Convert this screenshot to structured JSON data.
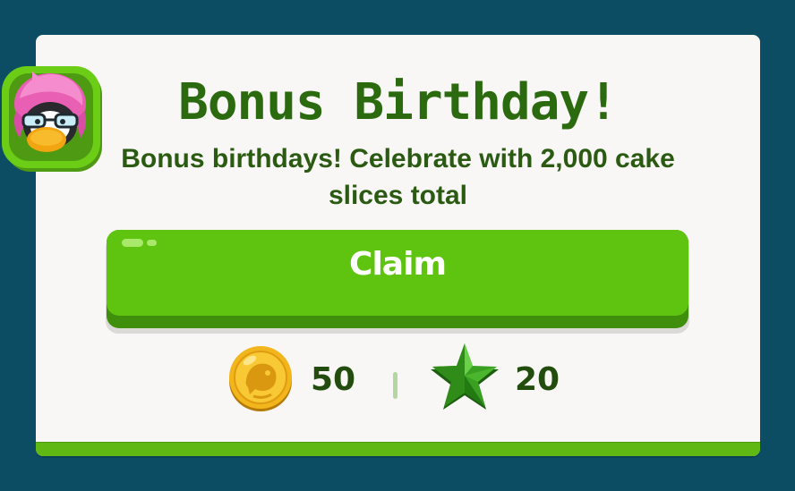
{
  "popup": {
    "title": "Bonus Birthday!",
    "description": "Bonus birthdays! Celebrate with 2,000 cake slices total",
    "claim_label": "Claim"
  },
  "rewards": {
    "coins": "50",
    "stars": "20"
  },
  "icons": {
    "avatar": "penguin-avatar-icon",
    "coin": "coin-icon",
    "star": "star-icon"
  },
  "colors": {
    "background": "#0c4d64",
    "card": "#f8f7f5",
    "title": "#2c6a10",
    "button": "#5fc40f",
    "button_shadow": "#3f8e0c",
    "text": "#224d0e"
  }
}
